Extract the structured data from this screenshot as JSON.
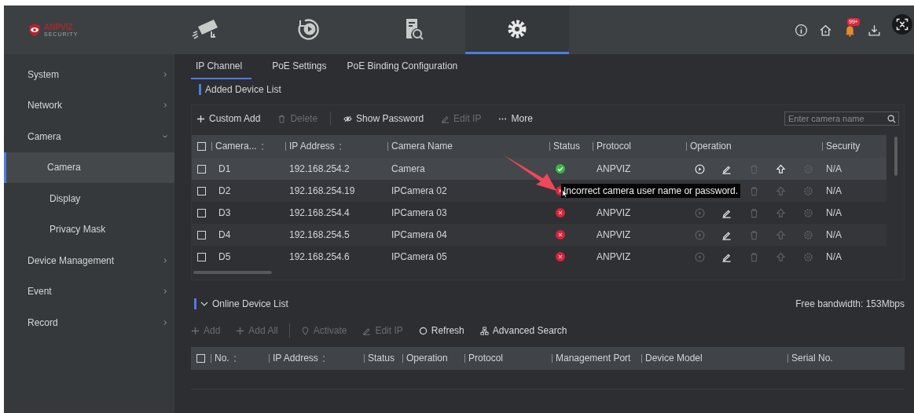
{
  "logo": {
    "brand": "ANPVIZ",
    "tagline": "SECURITY"
  },
  "nav": [
    {
      "kind": "camera",
      "selected": false
    },
    {
      "kind": "playback",
      "selected": false
    },
    {
      "kind": "search",
      "selected": false
    },
    {
      "kind": "settings",
      "selected": true
    }
  ],
  "header_tools": {
    "notification_badge": "99+"
  },
  "sidebar": {
    "items": [
      {
        "label": "System",
        "expanded": false,
        "selected": false
      },
      {
        "label": "Network",
        "expanded": false,
        "selected": false
      },
      {
        "label": "Camera",
        "expanded": true,
        "selected": false,
        "children": [
          {
            "label": "Camera",
            "selected": true
          },
          {
            "label": "Display",
            "selected": false
          },
          {
            "label": "Privacy Mask",
            "selected": false
          }
        ]
      },
      {
        "label": "Device Management",
        "expanded": false,
        "selected": false
      },
      {
        "label": "Event",
        "expanded": false,
        "selected": false
      },
      {
        "label": "Record",
        "expanded": false,
        "selected": false
      }
    ]
  },
  "tabs": [
    {
      "label": "IP Channel",
      "selected": true
    },
    {
      "label": "PoE Settings",
      "selected": false
    },
    {
      "label": "PoE Binding Configuration",
      "selected": false
    }
  ],
  "added_device_list": {
    "title": "Added Device List",
    "toolbar": [
      {
        "kind": "add",
        "label": "Custom Add",
        "disabled": false
      },
      {
        "kind": "delete",
        "label": "Delete",
        "disabled": true
      },
      {
        "kind": "separator"
      },
      {
        "kind": "eye",
        "label": "Show Password",
        "disabled": false
      },
      {
        "kind": "edit",
        "label": "Edit IP",
        "disabled": true
      },
      {
        "kind": "more",
        "label": "More",
        "disabled": false
      }
    ],
    "search": {
      "placeholder": "Enter camera name"
    },
    "select_all": {
      "checked": false
    },
    "columns": [
      {
        "label": "Camera...",
        "sortable": true
      },
      {
        "label": "IP Address",
        "sortable": true
      },
      {
        "label": "Camera Name",
        "sortable": false
      },
      {
        "label": "Status",
        "sortable": false
      },
      {
        "label": "Protocol",
        "sortable": false
      },
      {
        "label": "Operation",
        "sortable": false
      },
      {
        "label": "Security",
        "sortable": false
      }
    ],
    "rows": [
      {
        "checked": false,
        "highlighted": true,
        "channel": "D1",
        "ip": "192.168.254.2",
        "name": "Camera",
        "connected": true,
        "protocol": "ANPVIZ",
        "operations": [
          {
            "kind": "play",
            "disabled": false
          },
          {
            "kind": "edit",
            "disabled": false
          },
          {
            "kind": "delete",
            "disabled": true
          },
          {
            "kind": "upgrade",
            "disabled": false
          },
          {
            "kind": "settings",
            "disabled": true
          }
        ],
        "security": "N/A"
      },
      {
        "checked": false,
        "highlighted": false,
        "channel": "D2",
        "ip": "192.168.254.19",
        "name": "IPCamera 02",
        "connected": false,
        "operations": [
          {
            "kind": "delete",
            "disabled": true
          },
          {
            "kind": "upgrade",
            "disabled": true
          },
          {
            "kind": "settings",
            "disabled": true
          }
        ],
        "security": "N/A",
        "tooltip": "Incorrect camera user name or password."
      },
      {
        "checked": false,
        "highlighted": false,
        "channel": "D3",
        "ip": "192.168.254.4",
        "name": "IPCamera 03",
        "connected": false,
        "protocol": "ANPVIZ",
        "operations": [
          {
            "kind": "play",
            "disabled": true
          },
          {
            "kind": "edit",
            "disabled": false
          },
          {
            "kind": "delete",
            "disabled": true
          },
          {
            "kind": "upgrade",
            "disabled": true
          },
          {
            "kind": "settings",
            "disabled": true
          }
        ],
        "security": "N/A"
      },
      {
        "checked": false,
        "highlighted": false,
        "channel": "D4",
        "ip": "192.168.254.5",
        "name": "IPCamera 04",
        "connected": false,
        "protocol": "ANPVIZ",
        "operations": [
          {
            "kind": "play",
            "disabled": true
          },
          {
            "kind": "edit",
            "disabled": false
          },
          {
            "kind": "delete",
            "disabled": true
          },
          {
            "kind": "upgrade",
            "disabled": true
          },
          {
            "kind": "settings",
            "disabled": true
          }
        ],
        "security": "N/A"
      },
      {
        "checked": false,
        "highlighted": false,
        "channel": "D5",
        "ip": "192.168.254.6",
        "name": "IPCamera 05",
        "connected": false,
        "protocol": "ANPVIZ",
        "operations": [
          {
            "kind": "play",
            "disabled": true
          },
          {
            "kind": "edit",
            "disabled": false
          },
          {
            "kind": "delete",
            "disabled": true
          },
          {
            "kind": "upgrade",
            "disabled": true
          },
          {
            "kind": "settings",
            "disabled": true
          }
        ],
        "security": "N/A"
      }
    ]
  },
  "online_device_list": {
    "title": "Online Device List",
    "expanded": true,
    "bandwidth": "Free bandwidth: 153Mbps",
    "toolbar": [
      {
        "kind": "add",
        "label": "Add",
        "disabled": true
      },
      {
        "kind": "add",
        "label": "Add All",
        "disabled": true
      },
      {
        "kind": "separator"
      },
      {
        "kind": "activate",
        "label": "Activate",
        "disabled": true
      },
      {
        "kind": "edit",
        "label": "Edit IP",
        "disabled": true
      },
      {
        "kind": "refresh",
        "label": "Refresh",
        "disabled": false
      },
      {
        "kind": "network",
        "label": "Advanced Search",
        "disabled": false
      }
    ],
    "select_all": {
      "checked": false
    },
    "columns": [
      {
        "label": "No.",
        "sortable": true
      },
      {
        "label": "IP Address",
        "sortable": true
      },
      {
        "label": "Status",
        "sortable": false
      },
      {
        "label": "Operation",
        "sortable": false
      },
      {
        "label": "Protocol",
        "sortable": false
      },
      {
        "label": "Management Port",
        "sortable": false
      },
      {
        "label": "Device Model",
        "sortable": false
      },
      {
        "label": "Serial No.",
        "sortable": false
      }
    ]
  }
}
